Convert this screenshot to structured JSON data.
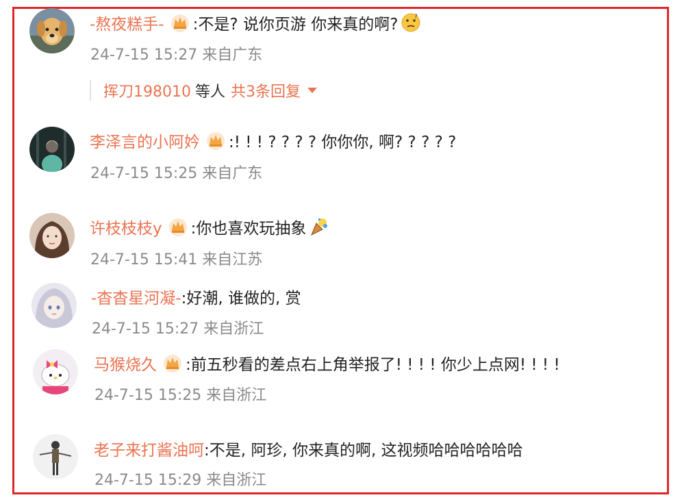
{
  "comments": [
    {
      "username": "-熬夜糕手-",
      "text": ":不是? 说你页游  你来真的啊?",
      "time": "24-7-15 15:27",
      "location": "来自广东",
      "badge_icon": "crown-badge-icon",
      "emoji_icon": "thinking-face-emoji",
      "replies": {
        "who": "挥刀198010",
        "mid": "等人",
        "count": "共3条回复"
      }
    },
    {
      "username": "李泽言的小阿妗",
      "text": ":! ! ! ? ? ? ? 你你你, 啊? ? ? ? ?",
      "time": "24-7-15 15:25",
      "location": "来自广东",
      "badge_icon": "crown-badge-icon"
    },
    {
      "username": "许枝枝枝y",
      "text": ":你也喜欢玩抽象",
      "time": "24-7-15 15:41",
      "location": "来自江苏",
      "badge_icon": "crown-badge-icon",
      "emoji_icon": "party-popper-emoji"
    },
    {
      "username": "-杳杳星河凝-",
      "text": ":好潮, 谁做的, 赏",
      "time": "24-7-15 15:27",
      "location": "来自浙江"
    },
    {
      "username": "马猴烧久",
      "text": ":前五秒看的差点右上角举报了! ! ! ! 你少上点网! ! ! !",
      "time": "24-7-15 15:25",
      "location": "来自浙江",
      "badge_icon": "crown-badge-icon"
    },
    {
      "username": "老子来打酱油呵",
      "text": ":不是, 阿珍, 你来真的啊, 这视频哈哈哈哈哈哈",
      "time": "24-7-15 15:29",
      "location": "来自浙江"
    }
  ],
  "colors": {
    "frame": "#e0252a",
    "username": "#eb7350",
    "meta": "#8a8a8a",
    "text": "#222222"
  }
}
